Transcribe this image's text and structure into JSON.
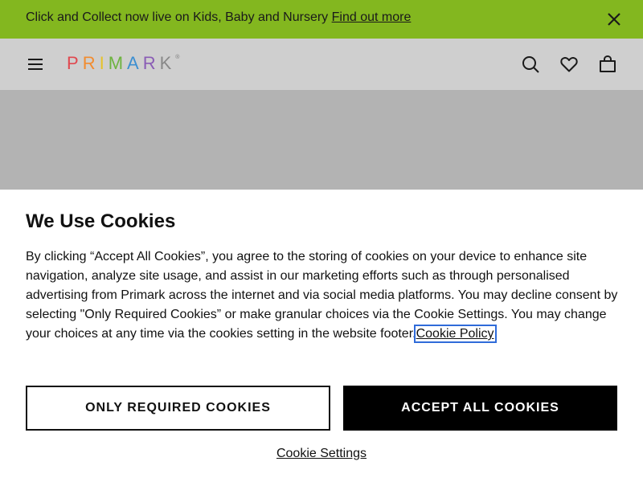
{
  "banner": {
    "text": "Click and Collect now live on Kids, Baby and Nursery ",
    "link": "Find out more",
    "close_icon": "close-icon",
    "background": "#83b71f"
  },
  "header": {
    "menu_icon": "menu-icon",
    "logo": {
      "letters": [
        "P",
        "R",
        "I",
        "M",
        "A",
        "R",
        "K"
      ],
      "registered": "®",
      "letter_colors": [
        "#e0484f",
        "#f28c2f",
        "#e6c229",
        "#6db33f",
        "#3d8fd1",
        "#8a5cb5",
        "#888888"
      ]
    },
    "icons": [
      "search-icon",
      "heart-icon",
      "bag-icon"
    ]
  },
  "cookie": {
    "title": "We Use Cookies",
    "body": "By clicking “Accept All Cookies”, you agree to the storing of cookies on your device to enhance site navigation, analyze site usage, and assist in our marketing efforts such as through personalised advertising from Primark across the internet and via social media platforms. You may decline consent by selecting \"Only Required Cookies” or make granular choices via the Cookie Settings. You may change your choices at any time via the cookies setting in the website footer.",
    "policy_link": "Cookie Policy",
    "only_required": "ONLY REQUIRED COOKIES",
    "accept_all": "ACCEPT ALL COOKIES",
    "settings": "Cookie Settings"
  }
}
